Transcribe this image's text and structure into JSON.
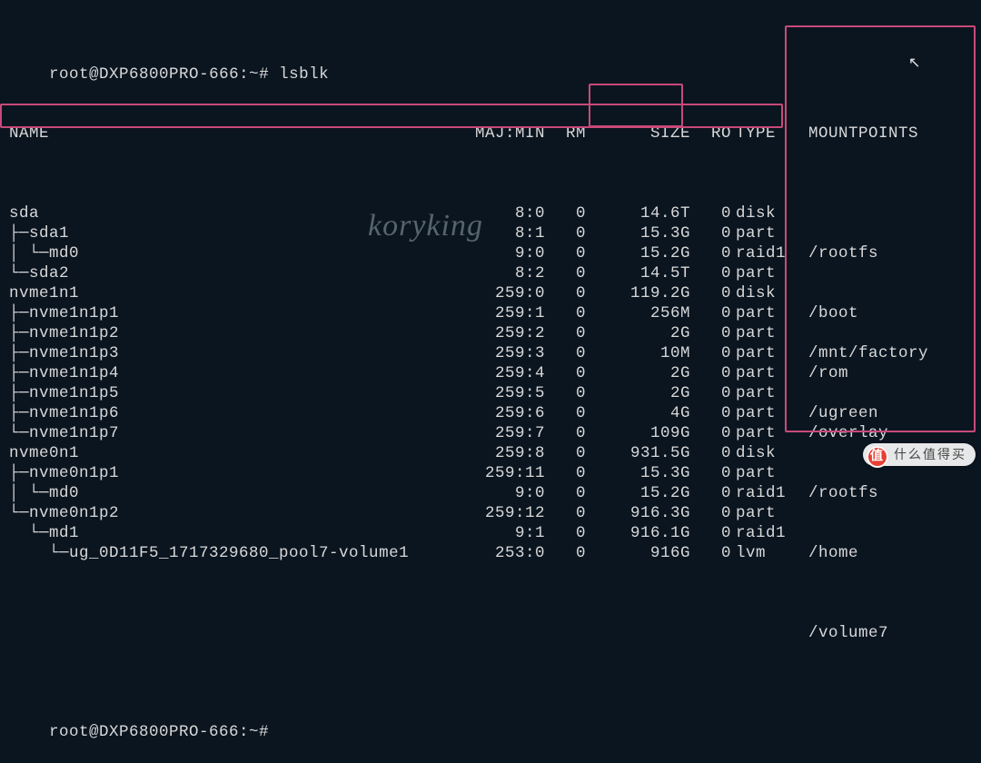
{
  "prompt": {
    "user": "root",
    "host": "DXP6800PRO-666",
    "path": "~",
    "symbol": "#",
    "command": "lsblk"
  },
  "headers": {
    "name": "NAME",
    "majmin": "MAJ:MIN",
    "rm": "RM",
    "size": "SIZE",
    "ro": "RO",
    "type": "TYPE",
    "mount": "MOUNTPOINTS"
  },
  "rows": [
    {
      "name": "sda",
      "majmin": "8:0",
      "rm": "0",
      "size": "14.6T",
      "ro": "0",
      "type": "disk",
      "mount": ""
    },
    {
      "name": "├─sda1",
      "majmin": "8:1",
      "rm": "0",
      "size": "15.3G",
      "ro": "0",
      "type": "part",
      "mount": ""
    },
    {
      "name": "│ └─md0",
      "majmin": "9:0",
      "rm": "0",
      "size": "15.2G",
      "ro": "0",
      "type": "raid1",
      "mount": "/rootfs"
    },
    {
      "name": "└─sda2",
      "majmin": "8:2",
      "rm": "0",
      "size": "14.5T",
      "ro": "0",
      "type": "part",
      "mount": ""
    },
    {
      "name": "nvme1n1",
      "majmin": "259:0",
      "rm": "0",
      "size": "119.2G",
      "ro": "0",
      "type": "disk",
      "mount": ""
    },
    {
      "name": "├─nvme1n1p1",
      "majmin": "259:1",
      "rm": "0",
      "size": "256M",
      "ro": "0",
      "type": "part",
      "mount": "/boot"
    },
    {
      "name": "├─nvme1n1p2",
      "majmin": "259:2",
      "rm": "0",
      "size": "2G",
      "ro": "0",
      "type": "part",
      "mount": ""
    },
    {
      "name": "├─nvme1n1p3",
      "majmin": "259:3",
      "rm": "0",
      "size": "10M",
      "ro": "0",
      "type": "part",
      "mount": "/mnt/factory"
    },
    {
      "name": "├─nvme1n1p4",
      "majmin": "259:4",
      "rm": "0",
      "size": "2G",
      "ro": "0",
      "type": "part",
      "mount": "/rom"
    },
    {
      "name": "├─nvme1n1p5",
      "majmin": "259:5",
      "rm": "0",
      "size": "2G",
      "ro": "0",
      "type": "part",
      "mount": ""
    },
    {
      "name": "├─nvme1n1p6",
      "majmin": "259:6",
      "rm": "0",
      "size": "4G",
      "ro": "0",
      "type": "part",
      "mount": "/ugreen"
    },
    {
      "name": "└─nvme1n1p7",
      "majmin": "259:7",
      "rm": "0",
      "size": "109G",
      "ro": "0",
      "type": "part",
      "mount": "/overlay"
    },
    {
      "name": "nvme0n1",
      "majmin": "259:8",
      "rm": "0",
      "size": "931.5G",
      "ro": "0",
      "type": "disk",
      "mount": ""
    },
    {
      "name": "├─nvme0n1p1",
      "majmin": "259:11",
      "rm": "0",
      "size": "15.3G",
      "ro": "0",
      "type": "part",
      "mount": ""
    },
    {
      "name": "│ └─md0",
      "majmin": "9:0",
      "rm": "0",
      "size": "15.2G",
      "ro": "0",
      "type": "raid1",
      "mount": "/rootfs"
    },
    {
      "name": "└─nvme0n1p2",
      "majmin": "259:12",
      "rm": "0",
      "size": "916.3G",
      "ro": "0",
      "type": "part",
      "mount": ""
    },
    {
      "name": "  └─md1",
      "majmin": "9:1",
      "rm": "0",
      "size": "916.1G",
      "ro": "0",
      "type": "raid1",
      "mount": ""
    },
    {
      "name": "    └─ug_0D11F5_1717329680_pool7-volume1",
      "majmin": "253:0",
      "rm": "0",
      "size": "916G",
      "ro": "0",
      "type": "lvm",
      "mount": "/home"
    }
  ],
  "extra_mount_line": "/volume7",
  "watermark": "koryking",
  "site_badge": "什么值得买",
  "prompt2": "root@DXP6800PRO-666:~#"
}
